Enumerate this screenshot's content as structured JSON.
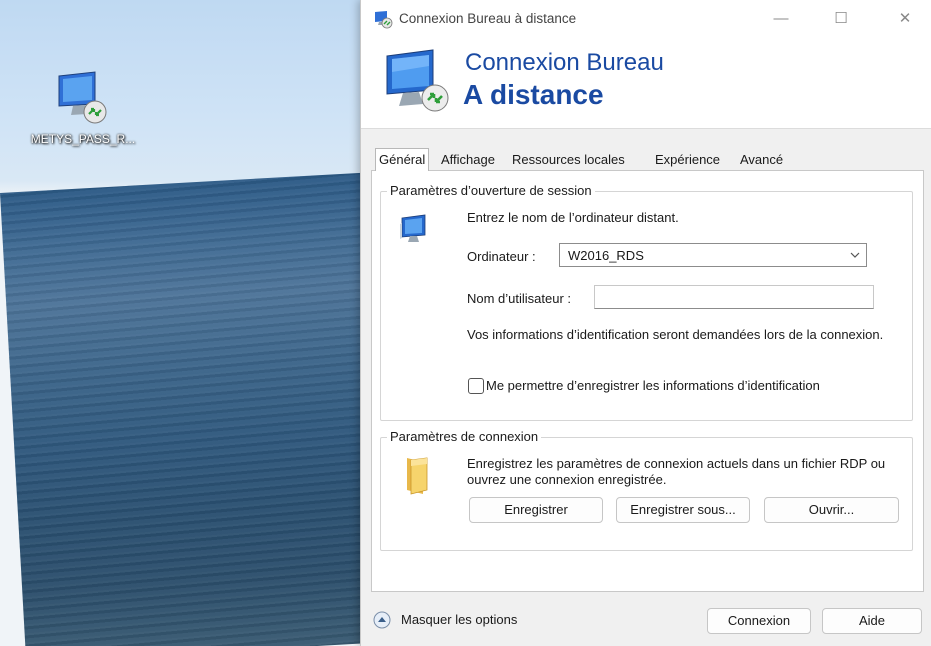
{
  "desktop": {
    "icon_label": "METYS_PASS_R..."
  },
  "window": {
    "title": "Connexion Bureau à distance",
    "controls": {
      "minimize": "—",
      "maximize": "☐",
      "close": "✕"
    },
    "banner": {
      "line1": "Connexion Bureau",
      "line2": "A distance"
    },
    "tabs": [
      "Général",
      "Affichage",
      "Ressources locales",
      "Expérience",
      "Avancé"
    ],
    "active_tab": "Général",
    "logon_group": {
      "legend": "Paramètres d’ouverture de session",
      "instruction": "Entrez le nom de l’ordinateur distant.",
      "computer_label": "Ordinateur :",
      "computer_value": "W2016_RDS",
      "username_label": "Nom d’utilisateur :",
      "username_value": "",
      "credentials_note": "Vos informations d’identification seront demandées lors de la connexion.",
      "save_credentials_label": "Me permettre d’enregistrer les informations d’identification",
      "save_credentials_checked": false
    },
    "connection_group": {
      "legend": "Paramètres de connexion",
      "description": "Enregistrez les paramètres de connexion actuels dans un fichier RDP ou ouvrez une connexion enregistrée.",
      "save_button": "Enregistrer",
      "save_as_button": "Enregistrer sous...",
      "open_button": "Ouvrir..."
    },
    "footer": {
      "hide_options": "Masquer les options",
      "connect_button": "Connexion",
      "help_button": "Aide"
    }
  },
  "icons": [
    "remote-desktop-icon",
    "computer-icon",
    "folder-icon",
    "chevron-down-icon",
    "collapse-icon"
  ],
  "colors": {
    "banner_text": "#1a4aa2",
    "window_bg": "#f0f0f0",
    "panel_bg": "#ffffff"
  }
}
